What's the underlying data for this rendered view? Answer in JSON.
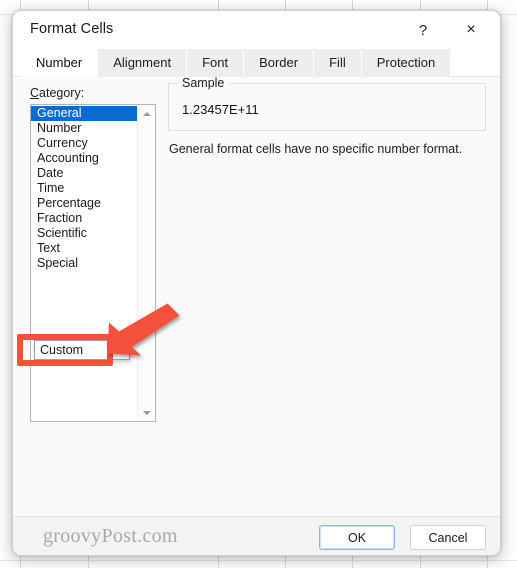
{
  "backdrop": {
    "description": "spreadsheet-grid",
    "column_lines_x": [
      20,
      88,
      218,
      285,
      352,
      420,
      487
    ],
    "row_lines_y": [
      14,
      560
    ]
  },
  "dialog": {
    "title": "Format Cells",
    "titlebar_buttons": [
      {
        "name": "help-button",
        "glyph": "?"
      },
      {
        "name": "close-button",
        "glyph": "×"
      }
    ],
    "tabs": [
      {
        "label": "Number",
        "active": true
      },
      {
        "label": "Alignment",
        "active": false
      },
      {
        "label": "Font",
        "active": false
      },
      {
        "label": "Border",
        "active": false
      },
      {
        "label": "Fill",
        "active": false
      },
      {
        "label": "Protection",
        "active": false
      }
    ],
    "category": {
      "label_prefix": "C",
      "label_rest": "ategory:",
      "items": [
        {
          "label": "General",
          "selected": true
        },
        {
          "label": "Number",
          "selected": false
        },
        {
          "label": "Currency",
          "selected": false
        },
        {
          "label": "Accounting",
          "selected": false
        },
        {
          "label": "Date",
          "selected": false
        },
        {
          "label": "Time",
          "selected": false
        },
        {
          "label": "Percentage",
          "selected": false
        },
        {
          "label": "Fraction",
          "selected": false
        },
        {
          "label": "Scientific",
          "selected": false
        },
        {
          "label": "Text",
          "selected": false
        },
        {
          "label": "Special",
          "selected": false
        }
      ],
      "popup_item": "Custom",
      "scrollbar": {
        "up_arrow": "scroll-up-arrow",
        "down_arrow": "scroll-down-arrow"
      }
    },
    "sample": {
      "legend": "Sample",
      "value": "1.23457E+11"
    },
    "format_description": "General format cells have no specific number format.",
    "footer": {
      "watermark": "groovyPost.com",
      "ok_label": "OK",
      "cancel_label": "Cancel"
    }
  },
  "annotation": {
    "highlight_color": "#f4513c",
    "arrow_name": "red-pointer-arrow",
    "highlight_name": "red-highlight-rectangle"
  },
  "colors": {
    "selection_blue": "#0b6bd3",
    "annotation_red": "#f4513c",
    "dialog_bg": "#f3f3f3",
    "panel_bg": "#fafafa"
  }
}
